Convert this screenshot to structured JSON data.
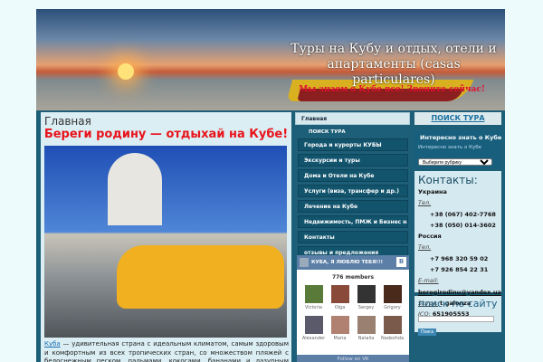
{
  "header": {
    "title": "Туры на Кубу и отдых, отели и апартаменты (casas particulares)",
    "slogan": "Мы знаем о Кубе все! Звоните сейчас!"
  },
  "main": {
    "breadcrumb": "Главная",
    "title": "Береги родину — отдыхай на Кубе!",
    "intro_link": "Куба",
    "intro_text": " — удивительная страна с идеальным климатом, самым здоровым и комфортным из всех тропических стран, со множеством пляжей с белоснежным песком, пальмами, кокосами, бананами и лазурным морем-океаном..."
  },
  "menu": {
    "home": "Главная",
    "search_label": "ПОИСК ТУРА",
    "items": [
      "Города и курорты КУБЫ",
      "Экскурсии и туры",
      "Дома и Отели на Кубе",
      "Услуги (виза, трансфер и др.)",
      "Лечение на Кубе",
      "Недвижимость, ПМЖ и Бизнес на",
      "Контакты",
      "отзывы и предложения"
    ]
  },
  "vk": {
    "title": "КУБА, Я ЛЮБЛЮ ТЕБЯ!!!",
    "badge": "B",
    "count": "776 members",
    "members": [
      "Victoria",
      "Olga",
      "Sergey",
      "Grigory",
      "Alexander",
      "Maria",
      "Natalia",
      "Nadezhda"
    ],
    "follow": "Follow on VK"
  },
  "right": {
    "tour_button": "ПОИСК ТУРА",
    "interest_title": "Интересно знать о Кубе",
    "interest_label": "Интересно знать о Кубе",
    "select_value": "Выберите рубрику",
    "contacts": {
      "heading": "Контакты:",
      "ukraine": "Украина",
      "tel_label": "Тел.",
      "ua_phones": [
        "+38 (067) 402-7768",
        "+38 (050) 014-3602"
      ],
      "russia": "Россия",
      "ru_phones": [
        "+7 968 320 59 02",
        "+7 926 854 22 31"
      ],
      "email_label": "E-mail:",
      "email": "beregirodinu@yandex.ua",
      "skype_label": "Skype:",
      "skype": "t.galonza",
      "icq_label": "ICQ:",
      "icq": "651905553"
    },
    "site_search": {
      "heading": "поиск по сайту",
      "button": "Поиск"
    }
  }
}
